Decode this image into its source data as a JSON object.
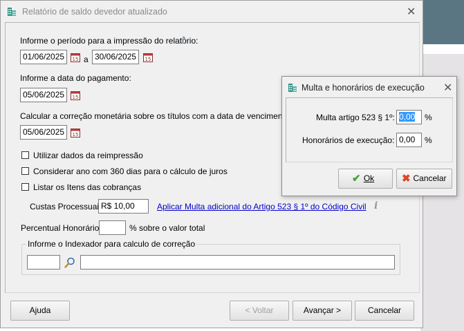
{
  "background": {
    "accent_color": "#5b7683",
    "panel_color": "#e6e3e6"
  },
  "dialog": {
    "icon": "building-icon",
    "title": "Relatório de saldo devedor atualizado",
    "close_icon": "close-icon",
    "period_label": "Informe o período para a impressão do relatório:",
    "period_start": "01/06/2025",
    "period_separator": "a",
    "period_end": "30/06/2025",
    "payment_label": "Informe a data do pagamento:",
    "payment_date": "05/06/2025",
    "correction_label": "Calcular a correção monetária sobre os títulos com a data de vencimento até:",
    "correction_date": "05/06/2025",
    "checkboxes": [
      {
        "label": "Utilizar dados da reimpressão",
        "checked": false
      },
      {
        "label": "Considerar ano com 360 dias para o cálculo de juros",
        "checked": false
      },
      {
        "label": "Listar os Itens das cobranças",
        "checked": false
      }
    ],
    "custas_label": "Custas Processuais:",
    "custas_value": "R$ 10,00",
    "multa_link": "Aplicar Multa adicional do Artigo 523 § 1º do Código Civil",
    "honorarios_label": "Percentual Honorários:",
    "honorarios_value": "",
    "honorarios_suffix": "% sobre o valor total",
    "indexador_legend": "Informe o Indexador para calculo de correção",
    "indexador_code": "",
    "indexador_desc": "",
    "buttons": {
      "help": "Ajuda",
      "back": "< Voltar",
      "next": "Avançar >",
      "cancel": "Cancelar"
    }
  },
  "subdialog": {
    "title": "Multa e honorários de execução",
    "close_icon": "close-icon",
    "multa_label": "Multa artigo 523 § 1º:",
    "multa_value": "0,00",
    "multa_unit": "%",
    "honorarios_label": "Honorários de execução:",
    "honorarios_value": "0,00",
    "honorarios_unit": "%",
    "ok_label": "Ok",
    "cancel_label": "Cancelar"
  }
}
